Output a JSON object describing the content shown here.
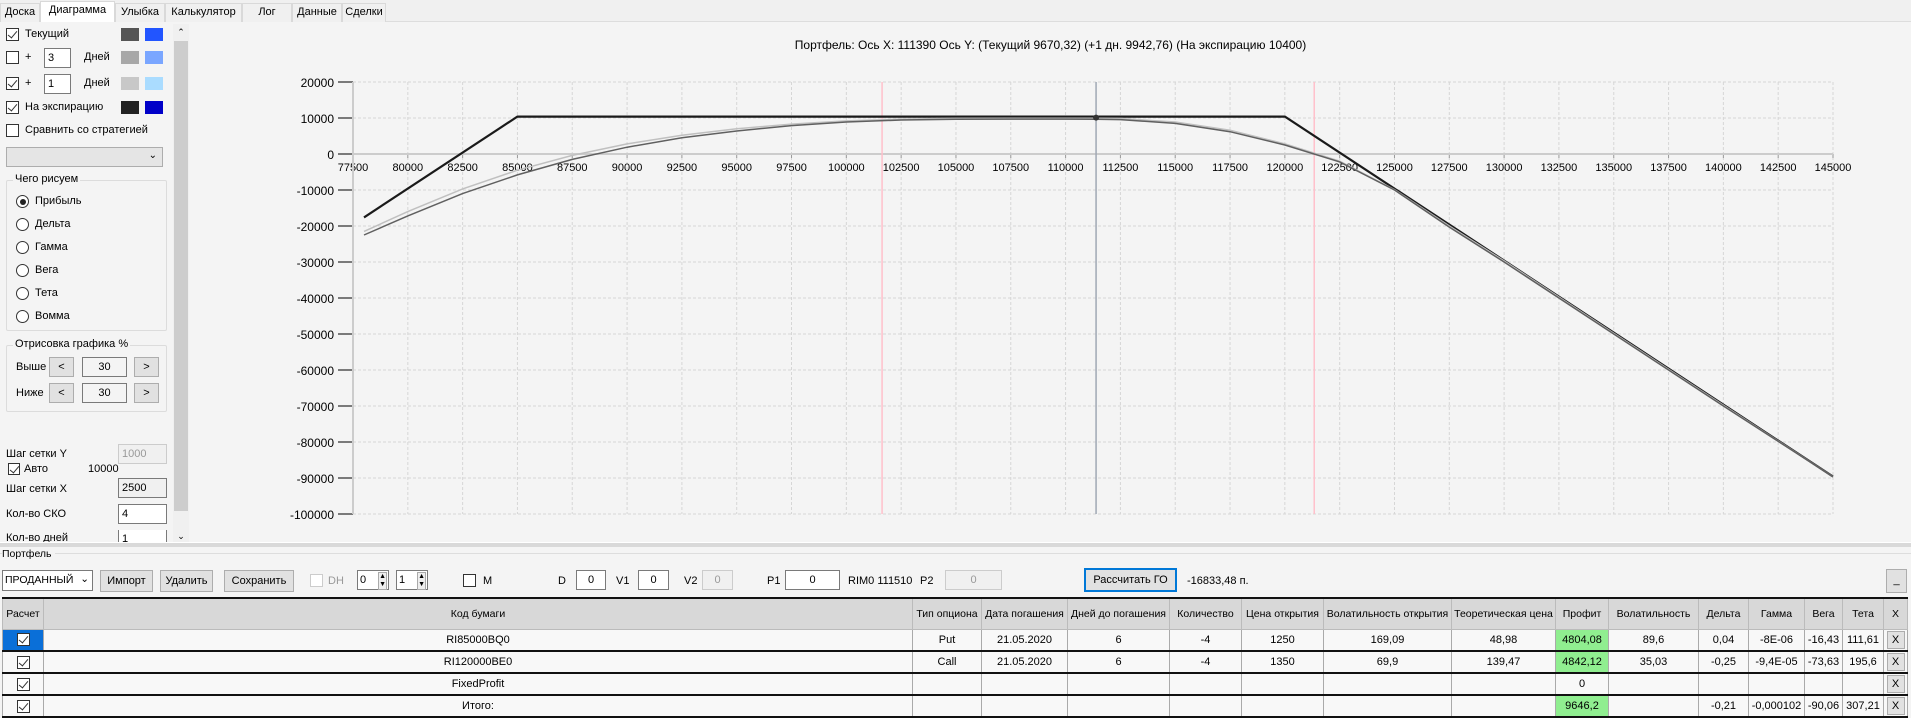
{
  "tabs": [
    "Доска",
    "Диаграмма",
    "Улыбка",
    "Калькулятор",
    "Лог",
    "Данные",
    "Сделки"
  ],
  "active_tab": "Диаграмма",
  "left_panel": {
    "current": {
      "label": "Текущий",
      "checked": true,
      "colors": [
        "#555555",
        "#2255ff"
      ]
    },
    "plus_a": {
      "plus": "+",
      "days": "3",
      "days_label": "Дней",
      "checked": false,
      "colors": [
        "#a8a8a8",
        "#7aa6ff"
      ]
    },
    "plus_b": {
      "plus": "+",
      "days": "1",
      "days_label": "Дней",
      "checked": true,
      "colors": [
        "#c8c8c8",
        "#aadcff"
      ]
    },
    "expiry": {
      "label": "На экспирацию",
      "checked": true,
      "colors": [
        "#222222",
        "#0000c8"
      ]
    },
    "compare": {
      "label": "Сравнить со стратегией",
      "checked": false
    },
    "strategy_select": "",
    "what_group": {
      "title": "Чего рисуем",
      "options": [
        "Прибыль",
        "Дельта",
        "Гамма",
        "Вега",
        "Тета",
        "Вомма"
      ],
      "selected": "Прибыль"
    },
    "draw_group": {
      "title": "Отрисовка графика %",
      "above_label": "Выше",
      "above": "30",
      "below_label": "Ниже",
      "below": "30",
      "dec": "<",
      "inc": ">"
    },
    "grid_y_label": "Шаг сетки Y",
    "grid_y": "1000",
    "auto_label": "Авто",
    "auto_checked": true,
    "auto_value": "10000",
    "grid_x_label": "Шаг сетки X",
    "grid_x": "2500",
    "sko_label": "Кол-во СКО",
    "sko": "4",
    "days_label": "Кол-во дней",
    "days": "1"
  },
  "chart_data": {
    "type": "line",
    "title": "Портфель: Ось X: 111390 Ось Y:  (Текущий 9670,32)  (+1 дн. 9942,76)  (На экспирацию 10400)",
    "xlim": [
      77500,
      145000
    ],
    "ylim": [
      -100000,
      20000
    ],
    "x_ticks": [
      77500,
      80000,
      82500,
      85000,
      87500,
      90000,
      92500,
      95000,
      97500,
      100000,
      102500,
      105000,
      107500,
      110000,
      112500,
      115000,
      117500,
      120000,
      122500,
      125000,
      127500,
      130000,
      132500,
      135000,
      137500,
      140000,
      142500,
      145000
    ],
    "y_ticks": [
      20000,
      10000,
      0,
      -10000,
      -20000,
      -30000,
      -40000,
      -50000,
      -60000,
      -70000,
      -80000,
      -90000,
      -100000
    ],
    "grid": true,
    "cursor_x": 111390,
    "sigma_lines": [
      101630,
      121340
    ],
    "series": [
      {
        "key": "expiry",
        "color": "#1a1a1a",
        "x": [
          78000,
          85000,
          120000,
          145000
        ],
        "y": [
          -17600,
          10400,
          10400,
          -89600
        ]
      },
      {
        "key": "plus1",
        "color": "#c0c0c0",
        "x": [
          78000,
          80000,
          82500,
          85000,
          87500,
          90000,
          92500,
          95000,
          97500,
          100000,
          102500,
          105000,
          107500,
          110000,
          111390,
          112500,
          115000,
          117500,
          120000,
          122500,
          125000,
          127500,
          130000,
          135000,
          140000,
          145000
        ],
        "y": [
          -21500,
          -16000,
          -9700,
          -4500,
          -400,
          2800,
          5200,
          7000,
          8300,
          9200,
          9700,
          9900,
          9950,
          9950,
          9943,
          9850,
          8900,
          6600,
          2800,
          -2000,
          -9900,
          -20000,
          -29700,
          -49800,
          -69800,
          -89600
        ]
      },
      {
        "key": "current",
        "color": "#606060",
        "x": [
          78000,
          80000,
          82500,
          85000,
          87500,
          90000,
          92500,
          95000,
          97500,
          100000,
          102500,
          105000,
          107500,
          110000,
          111390,
          112500,
          115000,
          117500,
          120000,
          122500,
          125000,
          127500,
          130000,
          135000,
          140000,
          145000
        ],
        "y": [
          -22500,
          -17200,
          -11000,
          -5800,
          -1500,
          1900,
          4500,
          6400,
          7900,
          8900,
          9450,
          9650,
          9700,
          9690,
          9670,
          9550,
          8500,
          6200,
          2500,
          -2200,
          -10000,
          -20300,
          -30000,
          -50000,
          -70000,
          -89600
        ]
      }
    ]
  },
  "portfolio": {
    "title": "Портфель",
    "type_select": "ПРОДАННЫЙ",
    "import": "Импорт",
    "delete": "Удалить",
    "save": "Сохранить",
    "dh_label": "DH",
    "spin1": "0",
    "spin2": "1",
    "m_label": "M",
    "d_label": "D",
    "d": "0",
    "v1_label": "V1",
    "v1": "0",
    "v2_label": "V2",
    "v2": "0",
    "p1_label": "P1",
    "p1": "0",
    "rim": "RIM0 111510",
    "p2_label": "P2",
    "p2": "0",
    "calc_go": "Рассчитать ГО",
    "go_value": "-16833,48 п.",
    "minimize": "_"
  },
  "table": {
    "headers": [
      "Расчет",
      "Код бумаги",
      "Тип опциона",
      "Дата погашения",
      "Дней до погашения",
      "Количество",
      "Цена открытия",
      "Волатильность открытия",
      "Теоретическая цена",
      "Профит",
      "Волатильность",
      "Дельта",
      "Гамма",
      "Вега",
      "Тета",
      "X"
    ],
    "rows": [
      {
        "checked": true,
        "cells": [
          "RI85000BQ0",
          "Put",
          "21.05.2020",
          "6",
          "-4",
          "1250",
          "169,09",
          "48,98",
          "4804,08",
          "89,6",
          "0,04",
          "-8E-06",
          "-16,43",
          "111,61"
        ],
        "green": true
      },
      {
        "checked": true,
        "cells": [
          "RI120000BE0",
          "Call",
          "21.05.2020",
          "6",
          "-4",
          "1350",
          "69,9",
          "139,47",
          "4842,12",
          "35,03",
          "-0,25",
          "-9,4E-05",
          "-73,63",
          "195,6"
        ],
        "green": true
      },
      {
        "checked": true,
        "cells": [
          "FixedProfit",
          "",
          "",
          "",
          "",
          "",
          "",
          "",
          "0",
          "",
          "",
          "",
          "",
          ""
        ],
        "green": false
      },
      {
        "checked": true,
        "cells": [
          "Итого:",
          "",
          "",
          "",
          "",
          "",
          "",
          "",
          "9646,2",
          "",
          "-0,21",
          "-0,000102",
          "-90,06",
          "307,21"
        ],
        "green": true
      }
    ],
    "delete_label": "X"
  }
}
